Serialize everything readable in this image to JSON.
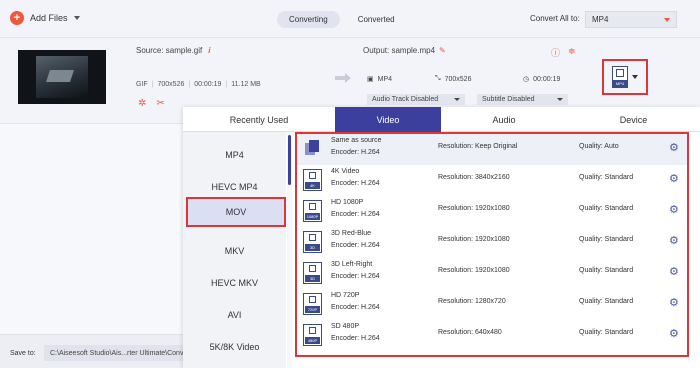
{
  "toolbar": {
    "add_files_label": "Add Files"
  },
  "mode_tabs": [
    {
      "label": "Converting",
      "active": true
    },
    {
      "label": "Converted",
      "active": false
    }
  ],
  "convert_all": {
    "label": "Convert All to:",
    "value": "MP4"
  },
  "file": {
    "source_label": "Source: sample.gif",
    "format": "GIF",
    "resolution": "700x526",
    "duration": "00:00:19",
    "size": "11.12 MB",
    "output_label": "Output: sample.mp4",
    "out_format": "MP4",
    "out_resolution": "700x526",
    "out_duration": "00:00:19",
    "audio_track": "Audio Track Disabled",
    "subtitle": "Subtitle Disabled",
    "format_badge": "MP4"
  },
  "save": {
    "label": "Save to:",
    "path": "C:\\Aiseesoft Studio\\Ais...rter Ultimate\\Converted"
  },
  "popup": {
    "tabs": [
      {
        "label": "Recently Used",
        "active": false
      },
      {
        "label": "Video",
        "active": true
      },
      {
        "label": "Audio",
        "active": false
      },
      {
        "label": "Device",
        "active": false
      }
    ],
    "formats": [
      "MP4",
      "HEVC MP4",
      "MOV",
      "MKV",
      "HEVC MKV",
      "AVI",
      "5K/8K Video"
    ],
    "selected_format": "MOV",
    "presets": [
      {
        "name": "Same as source",
        "badge": "",
        "encoder": "Encoder: H.264",
        "resolution": "Resolution: Keep Original",
        "quality": "Quality: Auto"
      },
      {
        "name": "4K Video",
        "badge": "4K",
        "encoder": "Encoder: H.264",
        "resolution": "Resolution: 3840x2160",
        "quality": "Quality: Standard"
      },
      {
        "name": "HD 1080P",
        "badge": "1080P",
        "encoder": "Encoder: H.264",
        "resolution": "Resolution: 1920x1080",
        "quality": "Quality: Standard"
      },
      {
        "name": "3D Red-Blue",
        "badge": "3D",
        "encoder": "Encoder: H.264",
        "resolution": "Resolution: 1920x1080",
        "quality": "Quality: Standard"
      },
      {
        "name": "3D Left-Right",
        "badge": "3D",
        "encoder": "Encoder: H.264",
        "resolution": "Resolution: 1920x1080",
        "quality": "Quality: Standard"
      },
      {
        "name": "HD 720P",
        "badge": "720P",
        "encoder": "Encoder: H.264",
        "resolution": "Resolution: 1280x720",
        "quality": "Quality: Standard"
      },
      {
        "name": "SD 480P",
        "badge": "480P",
        "encoder": "Encoder: H.264",
        "resolution": "Resolution: 640x480",
        "quality": "Quality: Standard"
      }
    ]
  },
  "colors": {
    "accent": "#f05a3b",
    "primary": "#3c3f9d",
    "highlight": "#e0343b"
  }
}
